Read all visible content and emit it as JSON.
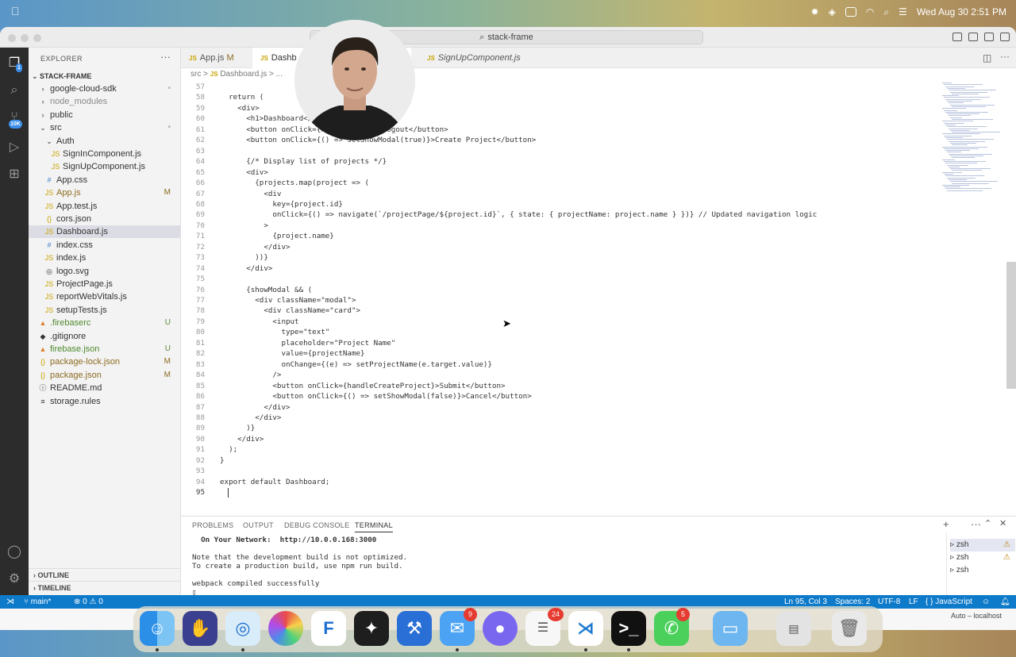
{
  "menubar": {
    "datetime": "Wed Aug 30  2:51 PM"
  },
  "window": {
    "search": "stack-frame"
  },
  "activity": {
    "badge_explorer": "1",
    "badge_scm": "10K"
  },
  "sidebar": {
    "header": "EXPLORER",
    "more": "···",
    "root": "STACK-FRAME",
    "items": [
      {
        "label": "google-cloud-sdk",
        "ic": "›",
        "depth": 1,
        "status": "•",
        "cls": "dot"
      },
      {
        "label": "node_modules",
        "ic": "›",
        "depth": 1,
        "status": "",
        "cls": "dot"
      },
      {
        "label": "public",
        "ic": "›",
        "depth": 1,
        "status": "",
        "cls": ""
      },
      {
        "label": "src",
        "ic": "⌄",
        "depth": 1,
        "status": "•",
        "cls": "dot"
      },
      {
        "label": "Auth",
        "ic": "⌄",
        "depth": 2,
        "status": "",
        "cls": ""
      },
      {
        "label": "SignInComponent.js",
        "ic": "JS",
        "depth": 3,
        "status": "",
        "cls": ""
      },
      {
        "label": "SignUpComponent.js",
        "ic": "JS",
        "depth": 3,
        "status": "",
        "cls": ""
      },
      {
        "label": "App.css",
        "ic": "#",
        "depth": 2,
        "status": "",
        "cls": ""
      },
      {
        "label": "App.js",
        "ic": "JS",
        "depth": 2,
        "status": "M",
        "cls": "m"
      },
      {
        "label": "App.test.js",
        "ic": "JS",
        "depth": 2,
        "status": "",
        "cls": ""
      },
      {
        "label": "cors.json",
        "ic": "{}",
        "depth": 2,
        "status": "",
        "cls": ""
      },
      {
        "label": "Dashboard.js",
        "ic": "JS",
        "depth": 2,
        "status": "",
        "cls": ""
      },
      {
        "label": "index.css",
        "ic": "#",
        "depth": 2,
        "status": "",
        "cls": ""
      },
      {
        "label": "index.js",
        "ic": "JS",
        "depth": 2,
        "status": "",
        "cls": ""
      },
      {
        "label": "logo.svg",
        "ic": "◎",
        "depth": 2,
        "status": "",
        "cls": ""
      },
      {
        "label": "ProjectPage.js",
        "ic": "JS",
        "depth": 2,
        "status": "",
        "cls": ""
      },
      {
        "label": "reportWebVitals.js",
        "ic": "JS",
        "depth": 2,
        "status": "",
        "cls": ""
      },
      {
        "label": "setupTests.js",
        "ic": "JS",
        "depth": 2,
        "status": "",
        "cls": ""
      },
      {
        "label": ".firebaserc",
        "ic": "▲",
        "depth": 1,
        "status": "U",
        "cls": "u"
      },
      {
        "label": ".gitignore",
        "ic": "◆",
        "depth": 1,
        "status": "",
        "cls": ""
      },
      {
        "label": "firebase.json",
        "ic": "▲",
        "depth": 1,
        "status": "U",
        "cls": "u"
      },
      {
        "label": "package-lock.json",
        "ic": "{}",
        "depth": 1,
        "status": "M",
        "cls": "m"
      },
      {
        "label": "package.json",
        "ic": "{}",
        "depth": 1,
        "status": "M",
        "cls": "m"
      },
      {
        "label": "README.md",
        "ic": "ⓘ",
        "depth": 1,
        "status": "",
        "cls": ""
      },
      {
        "label": "storage.rules",
        "ic": "≡",
        "depth": 1,
        "status": "",
        "cls": ""
      }
    ],
    "outline": "OUTLINE",
    "timeline": "TIMELINE"
  },
  "tabs": [
    {
      "label": "App.js",
      "status": "M"
    },
    {
      "label": "Dashb",
      "status": ""
    },
    {
      "label": "SignUpComponent.js",
      "status": ""
    }
  ],
  "breadcrumb": {
    "a": "src",
    "sep1": ">",
    "b": "Dashboard.js",
    "sep2": ">",
    "c": "..."
  },
  "code": [
    {
      "n": "57",
      "t": ""
    },
    {
      "n": "58",
      "t": "  return ("
    },
    {
      "n": "59",
      "t": "    <div>"
    },
    {
      "n": "60",
      "t": "      <h1>Dashboard</h1>"
    },
    {
      "n": "61",
      "t": "      <button onClick={handleLogout}>Logout</button>"
    },
    {
      "n": "62",
      "t": "      <button onClick={() => setShowModal(true)}>Create Project</button>"
    },
    {
      "n": "63",
      "t": ""
    },
    {
      "n": "64",
      "t": "      {/* Display list of projects */}"
    },
    {
      "n": "65",
      "t": "      <div>"
    },
    {
      "n": "66",
      "t": "        {projects.map(project => ("
    },
    {
      "n": "67",
      "t": "          <div"
    },
    {
      "n": "68",
      "t": "            key={project.id}"
    },
    {
      "n": "69",
      "t": "            onClick={() => navigate(`/projectPage/${project.id}`, { state: { projectName: project.name } })} // Updated navigation logic"
    },
    {
      "n": "70",
      "t": "          >"
    },
    {
      "n": "71",
      "t": "            {project.name}"
    },
    {
      "n": "72",
      "t": "          </div>"
    },
    {
      "n": "73",
      "t": "        ))}"
    },
    {
      "n": "74",
      "t": "      </div>"
    },
    {
      "n": "75",
      "t": ""
    },
    {
      "n": "76",
      "t": "      {showModal && ("
    },
    {
      "n": "77",
      "t": "        <div className=\"modal\">"
    },
    {
      "n": "78",
      "t": "          <div className=\"card\">"
    },
    {
      "n": "79",
      "t": "            <input"
    },
    {
      "n": "80",
      "t": "              type=\"text\""
    },
    {
      "n": "81",
      "t": "              placeholder=\"Project Name\""
    },
    {
      "n": "82",
      "t": "              value={projectName}"
    },
    {
      "n": "83",
      "t": "              onChange={(e) => setProjectName(e.target.value)}"
    },
    {
      "n": "84",
      "t": "            />"
    },
    {
      "n": "85",
      "t": "            <button onClick={handleCreateProject}>Submit</button>"
    },
    {
      "n": "86",
      "t": "            <button onClick={() => setShowModal(false)}>Cancel</button>"
    },
    {
      "n": "87",
      "t": "          </div>"
    },
    {
      "n": "88",
      "t": "        </div>"
    },
    {
      "n": "89",
      "t": "      )}"
    },
    {
      "n": "90",
      "t": "    </div>"
    },
    {
      "n": "91",
      "t": "  );"
    },
    {
      "n": "92",
      "t": "}"
    },
    {
      "n": "93",
      "t": ""
    },
    {
      "n": "94",
      "t": "export default Dashboard;"
    },
    {
      "n": "95",
      "t": ""
    }
  ],
  "panel": {
    "tabs": [
      "PROBLEMS",
      "OUTPUT",
      "DEBUG CONSOLE",
      "TERMINAL"
    ],
    "terminal": [
      "  On Your Network:  http://10.0.0.168:3000",
      "",
      "Note that the development build is not optimized.",
      "To create a production build, use npm run build.",
      "",
      "webpack compiled successfully",
      "▯"
    ],
    "shells": [
      "zsh",
      "zsh",
      "zsh"
    ]
  },
  "status": {
    "branch": "main*",
    "problems": "⊗ 0 ⚠ 0",
    "position": "Ln 95, Col 3",
    "spaces": "Spaces: 2",
    "encoding": "UTF-8",
    "eol": "LF",
    "language": "{ } JavaScript"
  },
  "bottom": {
    "browser": "Auto – localhost"
  },
  "dock": {
    "badge_mail": "9",
    "badge_reminders": "24",
    "badge_messages": "5"
  }
}
